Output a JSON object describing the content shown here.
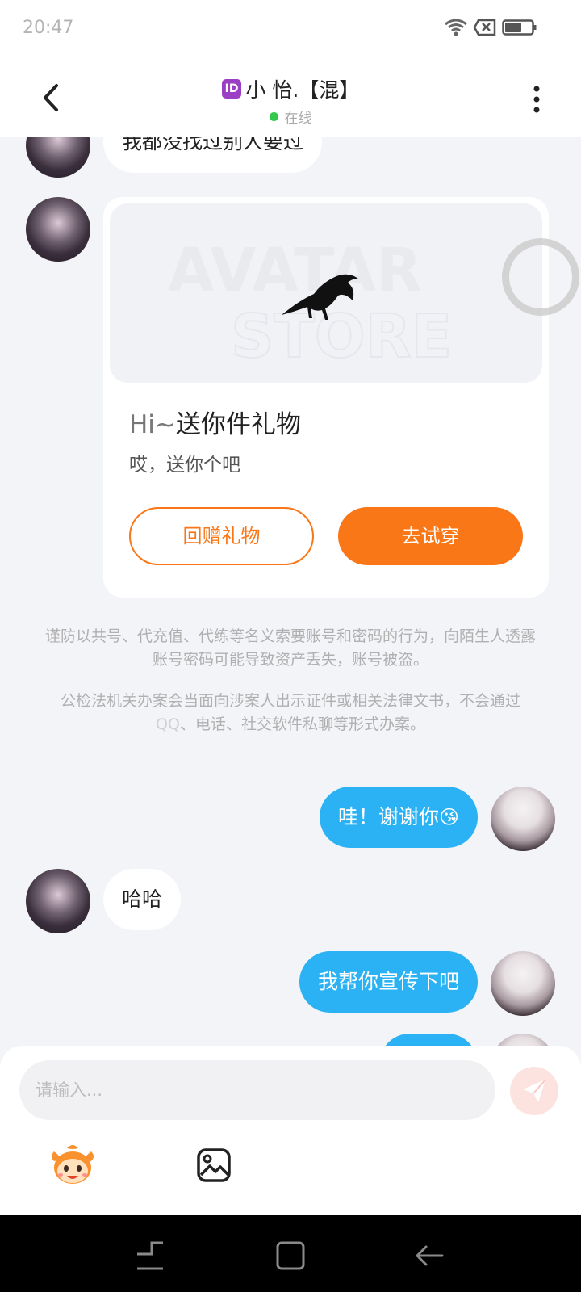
{
  "status_bar": {
    "time": "20:47",
    "icons": [
      "wifi-icon",
      "no-sim-icon",
      "battery-icon"
    ]
  },
  "header": {
    "id_badge": "ID",
    "title": "小 怡.【混】",
    "status": "在线",
    "status_color": "#33c94c"
  },
  "messages": {
    "m1": "我都没找过别人要过",
    "gift": {
      "title_prefix": "Hi~",
      "title": "送你件礼物",
      "subtitle": "哎，送你个吧",
      "btn_return": "回赠礼物",
      "btn_try": "去试穿",
      "watermark_top": "AVATAR",
      "watermark_bottom": "STORE"
    },
    "notice1": "谨防以共号、代充值、代练等名义索要账号和密码的行为，向陌生人透露账号密码可能导致资产丢失，账号被盗。",
    "notice2_prefix": "公检法机关办案会当面向涉案人出示证件或相关法律文书，不会通过",
    "notice2_qq": "QQ",
    "notice2_suffix": "、电话、社交软件私聊等形式办案。",
    "m2": "哇！谢谢你",
    "m2_emoji": "😘",
    "m3": "哈哈",
    "m4": "我帮你宣传下吧"
  },
  "input": {
    "placeholder": "请输入..."
  },
  "toolbar": {
    "items": [
      "emoji-icon",
      "image-icon"
    ]
  },
  "colors": {
    "accent": "#fa7718",
    "bubble_self": "#2ab2f4",
    "background": "#f3f4f8"
  }
}
